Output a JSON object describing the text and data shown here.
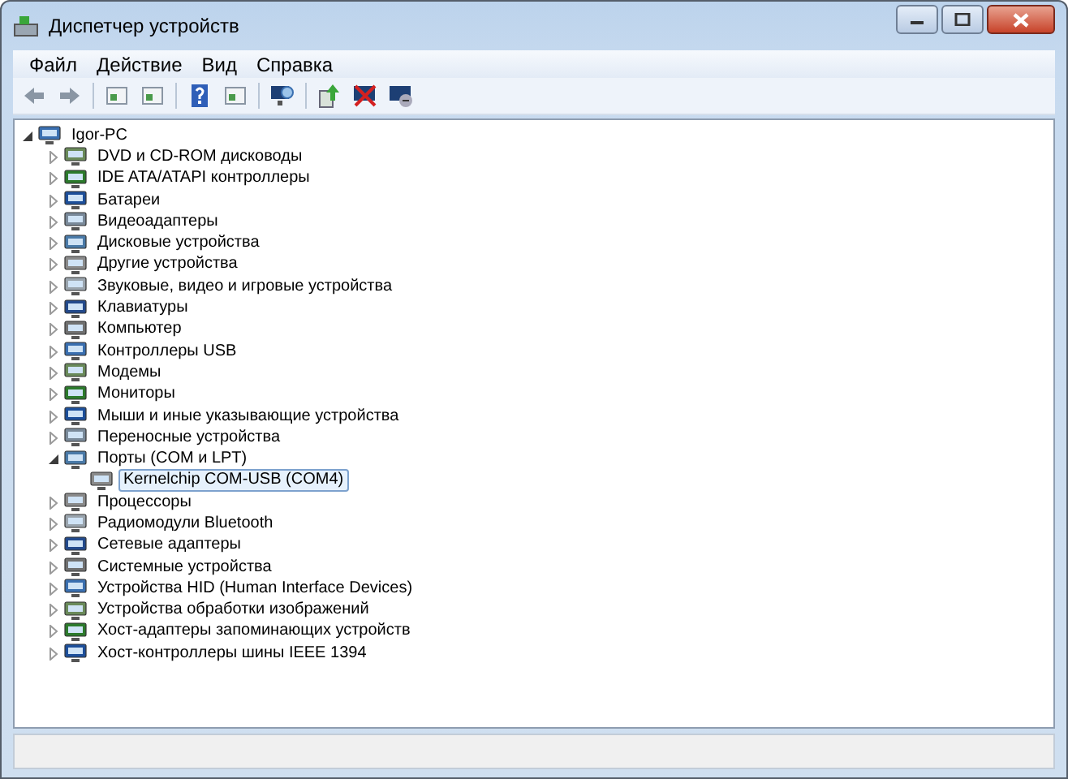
{
  "window": {
    "title": "Диспетчер устройств"
  },
  "menu": [
    {
      "label": "Файл"
    },
    {
      "label": "Действие"
    },
    {
      "label": "Вид"
    },
    {
      "label": "Справка"
    }
  ],
  "tree": [
    {
      "label": "Igor-PC",
      "expanded": true,
      "selected": false,
      "children": [
        {
          "label": "DVD и CD-ROM дисководы",
          "expanded": false,
          "selected": false
        },
        {
          "label": "IDE ATA/ATAPI контроллеры",
          "expanded": false,
          "selected": false
        },
        {
          "label": "Батареи",
          "expanded": false,
          "selected": false
        },
        {
          "label": "Видеоадаптеры",
          "expanded": false,
          "selected": false
        },
        {
          "label": "Дисковые устройства",
          "expanded": false,
          "selected": false
        },
        {
          "label": "Другие устройства",
          "expanded": false,
          "selected": false
        },
        {
          "label": "Звуковые, видео и игровые устройства",
          "expanded": false,
          "selected": false
        },
        {
          "label": "Клавиатуры",
          "expanded": false,
          "selected": false
        },
        {
          "label": "Компьютер",
          "expanded": false,
          "selected": false
        },
        {
          "label": "Контроллеры USB",
          "expanded": false,
          "selected": false
        },
        {
          "label": "Модемы",
          "expanded": false,
          "selected": false
        },
        {
          "label": "Мониторы",
          "expanded": false,
          "selected": false
        },
        {
          "label": "Мыши и иные указывающие устройства",
          "expanded": false,
          "selected": false
        },
        {
          "label": "Переносные устройства",
          "expanded": false,
          "selected": false
        },
        {
          "label": "Порты (COM и LPT)",
          "expanded": true,
          "selected": false,
          "children": [
            {
              "label": "Kernelchip COM-USB (COM4)",
              "selected": true
            }
          ]
        },
        {
          "label": "Процессоры",
          "expanded": false,
          "selected": false
        },
        {
          "label": "Радиомодули Bluetooth",
          "expanded": false,
          "selected": false
        },
        {
          "label": "Сетевые адаптеры",
          "expanded": false,
          "selected": false
        },
        {
          "label": "Системные устройства",
          "expanded": false,
          "selected": false
        },
        {
          "label": "Устройства HID (Human Interface Devices)",
          "expanded": false,
          "selected": false
        },
        {
          "label": "Устройства обработки изображений",
          "expanded": false,
          "selected": false
        },
        {
          "label": "Хост-адаптеры запоминающих устройств",
          "expanded": false,
          "selected": false
        },
        {
          "label": "Хост-контроллеры шины IEEE 1394",
          "expanded": false,
          "selected": false
        }
      ]
    }
  ]
}
